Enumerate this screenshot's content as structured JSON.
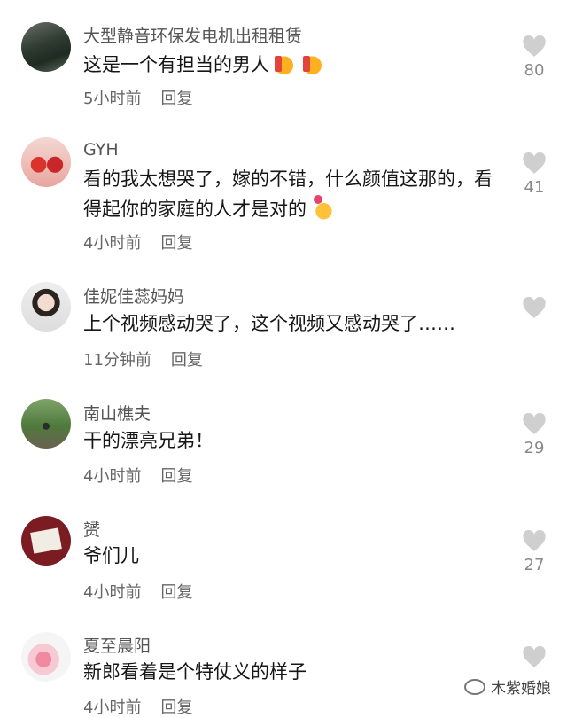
{
  "comments": [
    {
      "username": "大型静音环保发电机出租租赁",
      "text": "这是一个有担当的男人",
      "emojis": [
        "thumbs-up",
        "thumbs-up"
      ],
      "time": "5小时前",
      "reply": "回复",
      "likes": "80"
    },
    {
      "username": "GYH",
      "text": "看的我太想哭了，嫁的不错，什么颜值这那的，看得起你的家庭的人才是对的",
      "emojis": [
        "finger-heart"
      ],
      "time": "4小时前",
      "reply": "回复",
      "likes": "41"
    },
    {
      "username": "佳妮佳蕊妈妈",
      "text": "上个视频感动哭了，这个视频又感动哭了……",
      "emojis": [],
      "time": "11分钟前",
      "reply": "回复",
      "likes": ""
    },
    {
      "username": "南山樵夫",
      "text": "干的漂亮兄弟！",
      "emojis": [],
      "time": "4小时前",
      "reply": "回复",
      "likes": "29"
    },
    {
      "username": "赟",
      "text": "爷们儿",
      "emojis": [],
      "time": "4小时前",
      "reply": "回复",
      "likes": "27"
    },
    {
      "username": "夏至晨阳",
      "text": "新郎看着是个特仗义的样子",
      "emojis": [],
      "time": "4小时前",
      "reply": "回复",
      "likes": ""
    }
  ],
  "watermark": "木紫婚娘",
  "colors": {
    "background": "#ffffff",
    "username": "#555555",
    "text": "#161616",
    "meta": "#666666",
    "like_icon": "#cfcfcf",
    "like_count": "#8a8a8a"
  }
}
